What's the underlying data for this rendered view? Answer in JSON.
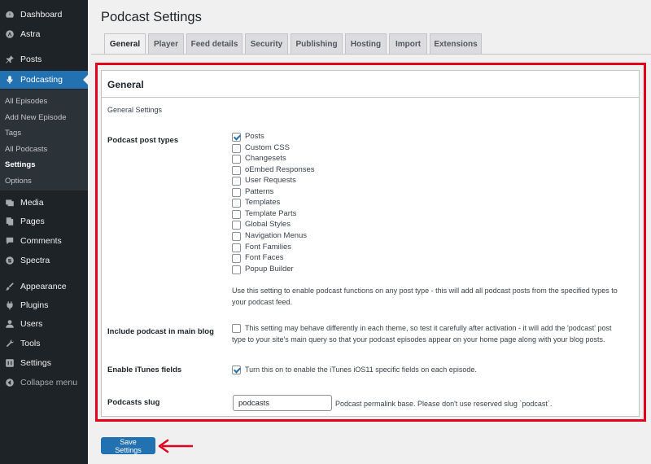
{
  "sidebar": {
    "items": [
      {
        "label": "Dashboard",
        "icon": "dashboard-icon"
      },
      {
        "label": "Astra",
        "icon": "astra-icon"
      },
      {
        "label": "Posts",
        "icon": "pin-icon"
      },
      {
        "label": "Podcasting",
        "icon": "microphone-icon"
      },
      {
        "label": "Media",
        "icon": "media-icon"
      },
      {
        "label": "Pages",
        "icon": "pages-icon"
      },
      {
        "label": "Comments",
        "icon": "comments-icon"
      },
      {
        "label": "Spectra",
        "icon": "spectra-icon"
      },
      {
        "label": "Appearance",
        "icon": "brush-icon"
      },
      {
        "label": "Plugins",
        "icon": "plugin-icon"
      },
      {
        "label": "Users",
        "icon": "users-icon"
      },
      {
        "label": "Tools",
        "icon": "tools-icon"
      },
      {
        "label": "Settings",
        "icon": "settings-icon"
      },
      {
        "label": "Collapse menu",
        "icon": "collapse-icon"
      }
    ],
    "submenu": [
      "All Episodes",
      "Add New Episode",
      "Tags",
      "All Podcasts",
      "Settings",
      "Options"
    ]
  },
  "page": {
    "title": "Podcast Settings"
  },
  "tabs": [
    "General",
    "Player",
    "Feed details",
    "Security",
    "Publishing",
    "Hosting",
    "Import",
    "Extensions"
  ],
  "panel": {
    "title": "General",
    "subtitle": "General Settings",
    "post_types_label": "Podcast post types",
    "post_types": [
      {
        "label": "Posts",
        "checked": true
      },
      {
        "label": "Custom CSS",
        "checked": false
      },
      {
        "label": "Changesets",
        "checked": false
      },
      {
        "label": "oEmbed Responses",
        "checked": false
      },
      {
        "label": "User Requests",
        "checked": false
      },
      {
        "label": "Patterns",
        "checked": false
      },
      {
        "label": "Templates",
        "checked": false
      },
      {
        "label": "Template Parts",
        "checked": false
      },
      {
        "label": "Global Styles",
        "checked": false
      },
      {
        "label": "Navigation Menus",
        "checked": false
      },
      {
        "label": "Font Families",
        "checked": false
      },
      {
        "label": "Font Faces",
        "checked": false
      },
      {
        "label": "Popup Builder",
        "checked": false
      }
    ],
    "post_types_desc_1": "Use this setting to enable podcast functions on any post type - this will add all podcast posts from the specified types to",
    "post_types_desc_2": "your podcast feed.",
    "main_blog_label": "Include podcast in main blog",
    "main_blog_checked": false,
    "main_blog_desc_1": "This setting may behave differently in each theme, so test it carefully after activation - it will add the 'podcast' post",
    "main_blog_desc_2": "type to your site's main query so that your podcast episodes appear on your home page along with your blog posts.",
    "itunes_label": "Enable iTunes fields",
    "itunes_checked": true,
    "itunes_desc": "Turn this on to enable the iTunes iOS11 specific fields on each episode.",
    "slug_label": "Podcasts slug",
    "slug_value": "podcasts",
    "slug_desc": "Podcast permalink base. Please don't use reserved slug `podcast`."
  },
  "save_label": "Save Settings",
  "colors": {
    "accent": "#2271b1",
    "highlight": "#e2001a",
    "sidebar": "#1d2327"
  }
}
